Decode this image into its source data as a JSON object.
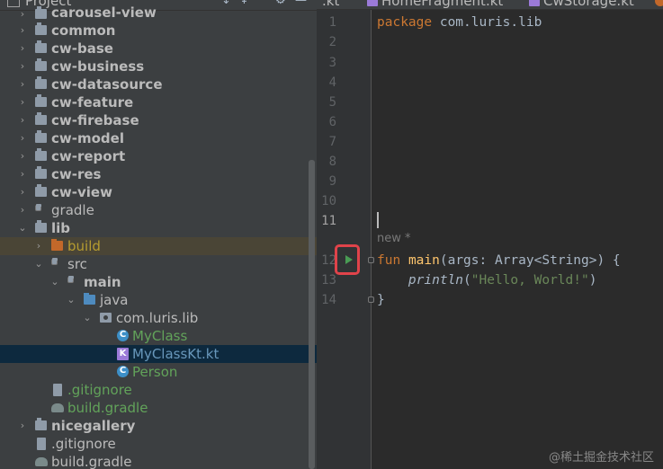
{
  "project_panel": {
    "title": "Project",
    "header_icons": [
      "collapse-icon",
      "scroll-to-icon",
      "settings-icon",
      "hide-icon"
    ],
    "partial_top": "carousel-view",
    "tree": [
      {
        "label": "common",
        "icon": "module-icon",
        "style": "bold",
        "expanded": false
      },
      {
        "label": "cw-base",
        "icon": "module-icon",
        "style": "bold",
        "expanded": false
      },
      {
        "label": "cw-business",
        "icon": "module-icon",
        "style": "bold",
        "expanded": false
      },
      {
        "label": "cw-datasource",
        "icon": "module-icon",
        "style": "bold",
        "expanded": false
      },
      {
        "label": "cw-feature",
        "icon": "module-icon",
        "style": "bold",
        "expanded": false
      },
      {
        "label": "cw-firebase",
        "icon": "module-icon",
        "style": "bold",
        "expanded": false
      },
      {
        "label": "cw-model",
        "icon": "module-icon",
        "style": "bold",
        "expanded": false
      },
      {
        "label": "cw-report",
        "icon": "module-icon",
        "style": "bold",
        "expanded": false
      },
      {
        "label": "cw-res",
        "icon": "module-icon",
        "style": "bold",
        "expanded": false
      },
      {
        "label": "cw-view",
        "icon": "module-icon",
        "style": "bold",
        "expanded": false
      },
      {
        "label": "gradle",
        "icon": "folder-icon",
        "style": "plain",
        "expanded": false
      },
      {
        "label": "lib",
        "icon": "module-icon",
        "style": "bold",
        "expanded": true
      },
      {
        "label": "build",
        "icon": "folder-icon",
        "style": "yellow",
        "expanded": false
      },
      {
        "label": "src",
        "icon": "folder-icon",
        "style": "plain",
        "expanded": true
      },
      {
        "label": "main",
        "icon": "folder-icon",
        "style": "bold",
        "expanded": true
      },
      {
        "label": "java",
        "icon": "folder-icon",
        "style": "plain",
        "expanded": true
      },
      {
        "label": "com.luris.lib",
        "icon": "package-icon",
        "style": "plain",
        "expanded": true
      },
      {
        "label": "MyClass",
        "icon": "class-icon",
        "style": "green"
      },
      {
        "label": "MyClassKt.kt",
        "icon": "kotlin-file-icon",
        "style": "blue",
        "selected": true
      },
      {
        "label": "Person",
        "icon": "class-icon",
        "style": "green"
      },
      {
        "label": ".gitignore",
        "icon": "file-icon",
        "style": "green"
      },
      {
        "label": "build.gradle",
        "icon": "gradle-icon",
        "style": "green"
      },
      {
        "label": "nicegallery",
        "icon": "module-icon",
        "style": "bold",
        "expanded": false
      },
      {
        "label": ".gitignore",
        "icon": "file-icon",
        "style": "plain"
      },
      {
        "label": "build.gradle",
        "icon": "gradle-icon",
        "style": "plain"
      }
    ]
  },
  "editor": {
    "tabs": [
      {
        "label": ".kt",
        "icon": "kotlin-file-icon"
      },
      {
        "label": "HomeFragment.kt",
        "icon": "kotlin-file-icon"
      },
      {
        "label": "CwStorage.kt",
        "icon": "kotlin-file-icon"
      }
    ],
    "line_numbers": [
      "1",
      "2",
      "3",
      "4",
      "5",
      "6",
      "7",
      "8",
      "9",
      "10",
      "11",
      "12",
      "13",
      "14"
    ],
    "current_line": "11",
    "code": {
      "l1_kw": "package",
      "l1_rest": " com.luris.lib",
      "hint": "new *",
      "l12_kw": "fun",
      "l12_fn": "main",
      "l12_open": "(",
      "l12_param": "args",
      "l12_rest": ": Array<String>) {",
      "l13_indent": "    ",
      "l13_fn": "println",
      "l13_open": "(",
      "l13_str": "\"Hello, World!\"",
      "l13_close": ")",
      "l14": "}"
    },
    "run_icon": "run-icon"
  },
  "watermark": "@稀土掘金技术社区",
  "colors": {
    "panel_bg": "#3c3f41",
    "editor_bg": "#2b2b2b",
    "keyword": "#cc7832",
    "function": "#ffc66d",
    "string": "#6a8759",
    "run_highlight": "#e0434a"
  }
}
